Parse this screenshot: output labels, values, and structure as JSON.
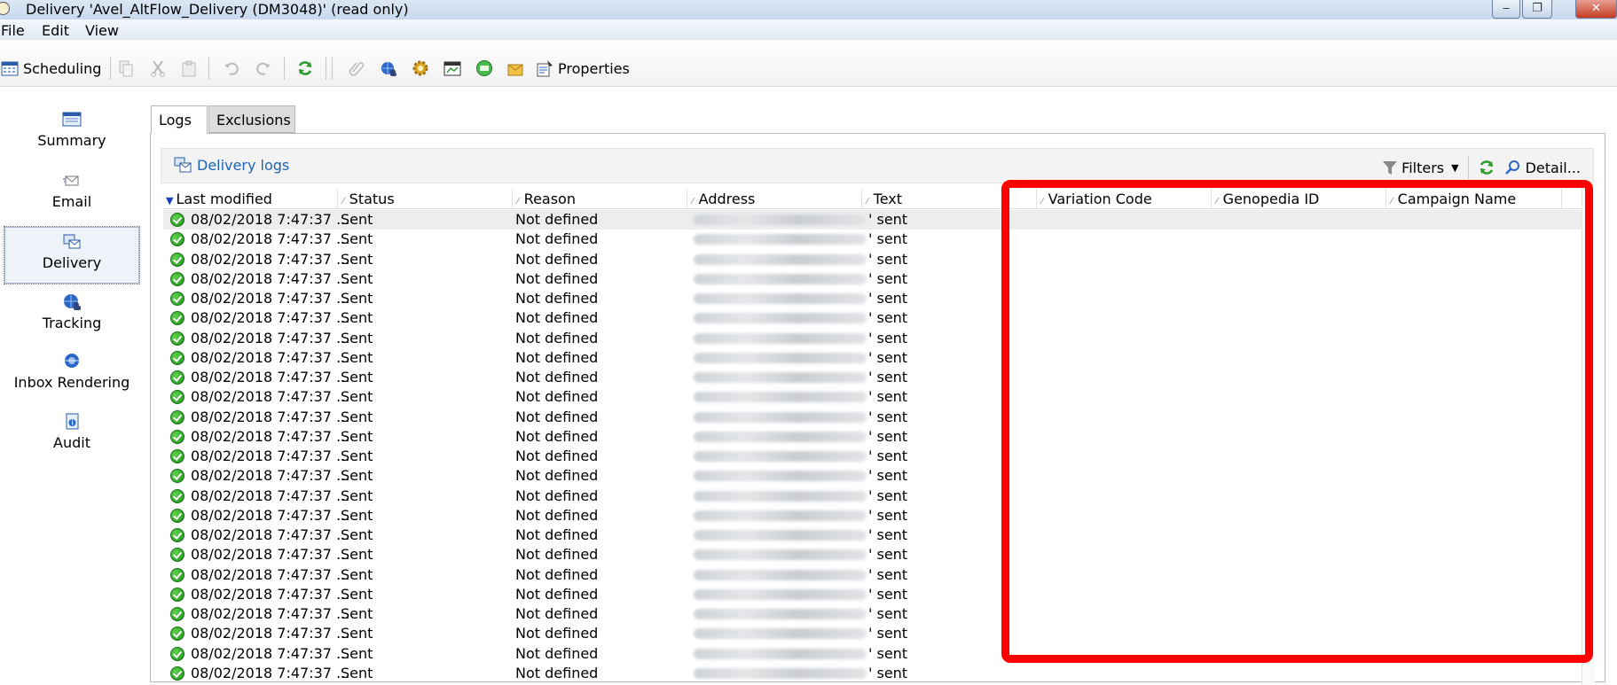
{
  "window": {
    "title": "Delivery 'Avel_AltFlow_Delivery (DM3048)' (read only)",
    "buttons": {
      "minimize": "‒",
      "restore": "❐",
      "close": "✕"
    }
  },
  "menu": [
    "File",
    "Edit",
    "View"
  ],
  "toolbar": {
    "scheduling_label": "Scheduling",
    "properties_label": "Properties"
  },
  "nav": [
    {
      "label": "Summary",
      "icon": "summary-icon"
    },
    {
      "label": "Email",
      "icon": "email-icon"
    },
    {
      "label": "Delivery",
      "icon": "delivery-icon",
      "active": true
    },
    {
      "label": "Tracking",
      "icon": "tracking-icon"
    },
    {
      "label": "Inbox Rendering",
      "icon": "inbox-rendering-icon"
    },
    {
      "label": "Audit",
      "icon": "audit-icon"
    }
  ],
  "tabs": [
    "Logs",
    "Exclusions"
  ],
  "subbar": {
    "delivery_logs": "Delivery logs",
    "filters": "Filters",
    "detail": "Detail..."
  },
  "columns": [
    "Last modified",
    "Status",
    "Reason",
    "Address",
    "Text",
    "Variation Code",
    "Genopedia ID",
    "Campaign Name"
  ],
  "rows": {
    "last_modified": "08/02/2018 7:47:37 ...",
    "status": "Sent",
    "reason": "Not defined",
    "text": "' sent",
    "count": 24
  },
  "colors": {
    "highlight": "#ff0000",
    "link": "#1f63b8"
  }
}
